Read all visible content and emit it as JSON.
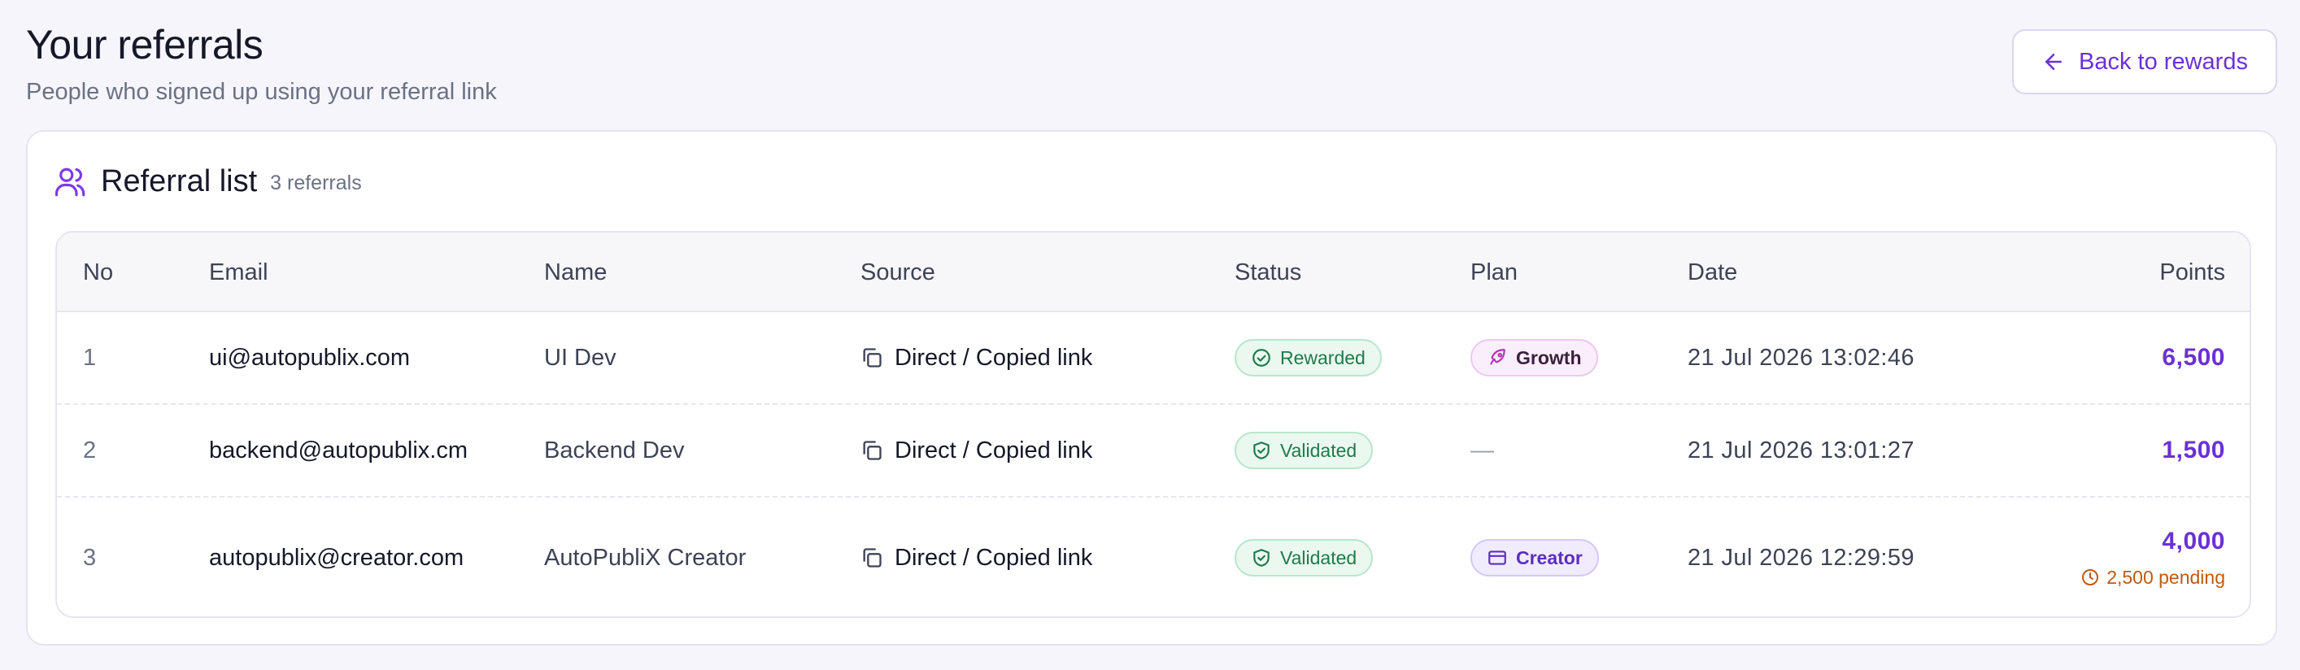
{
  "header": {
    "title": "Your referrals",
    "subtitle": "People who signed up using your referral link",
    "back_label": "Back to rewards"
  },
  "card": {
    "title": "Referral list",
    "count": "3 referrals"
  },
  "table": {
    "headers": {
      "no": "No",
      "email": "Email",
      "name": "Name",
      "source": "Source",
      "status": "Status",
      "plan": "Plan",
      "date": "Date",
      "points": "Points"
    },
    "rows": [
      {
        "no": "1",
        "email": "ui@autopublix.com",
        "name": "UI Dev",
        "source": "Direct / Copied link",
        "status": "Rewarded",
        "plan": "Growth",
        "date": "21 Jul 2026 13:02:46",
        "points": "6,500"
      },
      {
        "no": "2",
        "email": "backend@autopublix.cm",
        "name": "Backend Dev",
        "source": "Direct / Copied link",
        "status": "Validated",
        "plan": "—",
        "date": "21 Jul 2026 13:01:27",
        "points": "1,500"
      },
      {
        "no": "3",
        "email": "autopublix@creator.com",
        "name": "AutoPubliX Creator",
        "source": "Direct / Copied link",
        "status": "Validated",
        "plan": "Creator",
        "date": "21 Jul 2026 12:29:59",
        "points": "4,000",
        "pending": "2,500 pending"
      }
    ]
  },
  "icons": {
    "back": "arrow-left-icon",
    "card": "users-icon",
    "source": "copy-icon",
    "rewarded": "check-circle-icon",
    "validated": "shield-check-icon",
    "growth": "rocket-icon",
    "creator": "credit-card-icon",
    "pending": "clock-icon"
  },
  "colors": {
    "accent": "#6b31d6",
    "success": "#1f7a4a",
    "pending": "#c05a10",
    "background": "#f6f5fb"
  }
}
